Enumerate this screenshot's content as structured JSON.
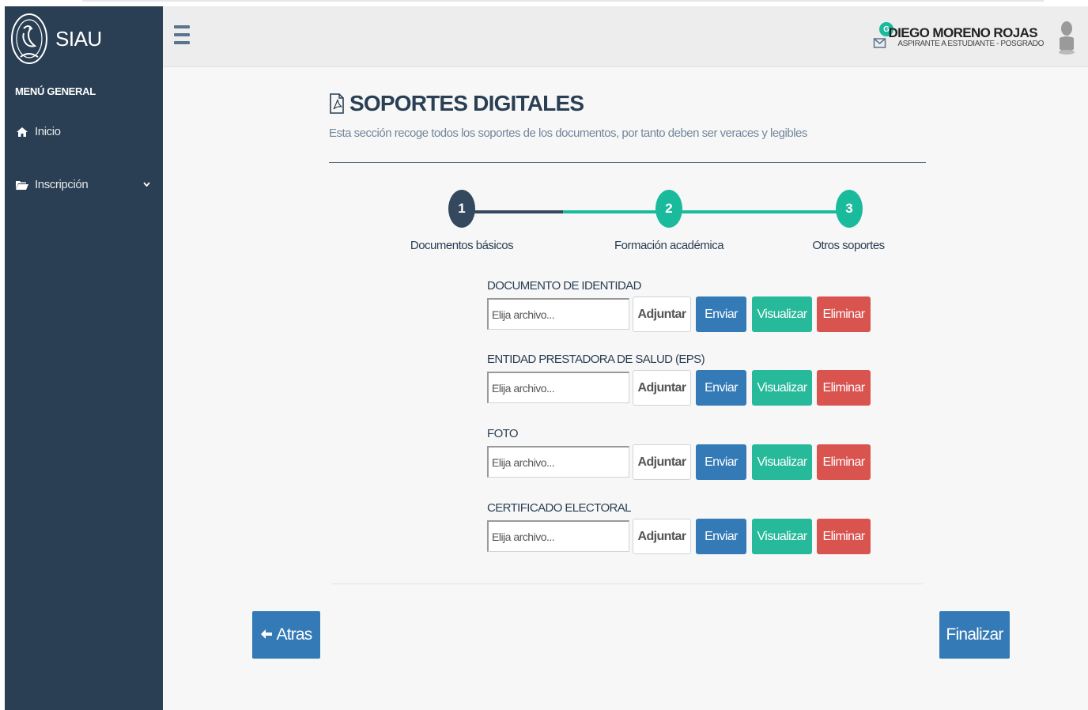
{
  "sidebar": {
    "brand_name": "SIAU",
    "menu_title": "MENÚ GENERAL",
    "items": [
      {
        "label": "Inicio",
        "icon": "home-icon"
      },
      {
        "label": "Inscripción",
        "icon": "folder-open-icon",
        "chevron": "chevron-down-icon"
      }
    ]
  },
  "topnav": {
    "notification_badge": "G",
    "user_name": "DIEGO MORENO ROJAS",
    "user_role": "ASPIRANTE A ESTUDIANTE - POSGRADO"
  },
  "page": {
    "title": "SOPORTES DIGITALES",
    "subtitle": "Esta sección recoge todos los soportes de los documentos, por tanto deben ser veraces y legibles"
  },
  "stepper": {
    "steps": [
      {
        "number": "1",
        "label": "Documentos básicos",
        "state": "completed"
      },
      {
        "number": "2",
        "label": "Formación académica",
        "state": "current"
      },
      {
        "number": "3",
        "label": "Otros soportes",
        "state": "current"
      }
    ]
  },
  "documents": [
    {
      "label": "DOCUMENTO DE IDENTIDAD",
      "placeholder": "Elija archivo..."
    },
    {
      "label": "ENTIDAD PRESTADORA DE SALUD (EPS)",
      "placeholder": "Elija archivo..."
    },
    {
      "label": "FOTO",
      "placeholder": "Elija archivo..."
    },
    {
      "label": "CERTIFICADO ELECTORAL",
      "placeholder": "Elija archivo..."
    }
  ],
  "buttons": {
    "adjuntar": "Adjuntar",
    "enviar": "Enviar",
    "visualizar": "Visualizar",
    "eliminar": "Eliminar",
    "atras": "Atras",
    "finalizar": "Finalizar"
  },
  "colors": {
    "sidebar": "#2a3f54",
    "primary": "#337ab7",
    "success": "#26b99a",
    "danger": "#d9534f",
    "step_done": "#34495e",
    "step_active": "#1abb9c"
  }
}
